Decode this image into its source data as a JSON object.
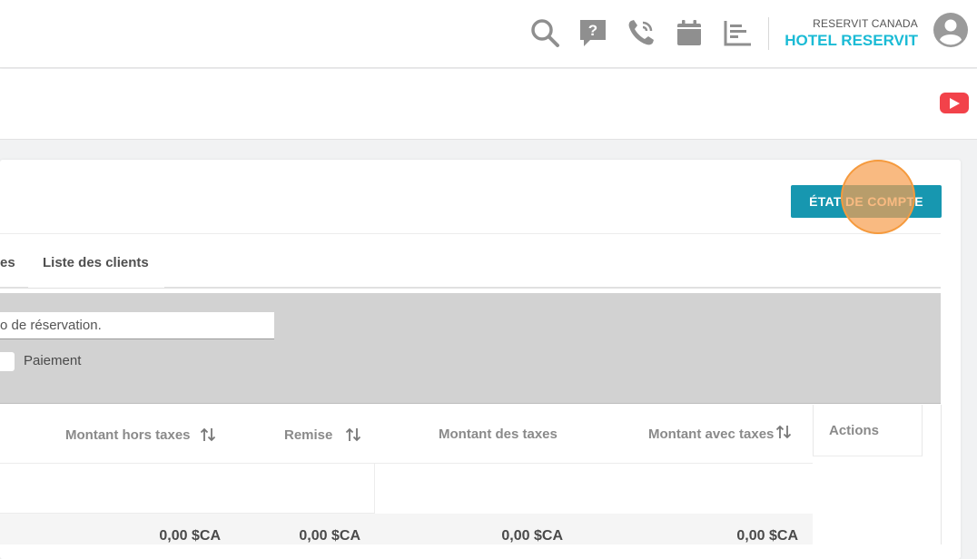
{
  "header": {
    "company_sub": "RESERVIT CANADA",
    "company_main": "HOTEL RESERVIT",
    "icons": [
      "search-icon",
      "help-icon",
      "phone-icon",
      "calendar-icon",
      "chart-icon",
      "user-avatar-icon"
    ]
  },
  "toolbar": {
    "etat_label": "ÉTAT DE COMPTE"
  },
  "tabs": [
    {
      "label": "es"
    },
    {
      "label": "Liste des clients"
    }
  ],
  "filters": {
    "search_value": "o de réservation.",
    "payment_label": "Paiement"
  },
  "table": {
    "columns": [
      "Montant hors taxes",
      "Remise",
      "Montant des taxes",
      "Montant avec taxes",
      "Actions"
    ],
    "totals": [
      "0,00 $CA",
      "0,00 $CA",
      "0,00 $CA",
      "0,00 $CA"
    ]
  },
  "colors": {
    "accent": "#1797b0",
    "brand": "#1bbbd5",
    "youtube": "#f2424a"
  }
}
